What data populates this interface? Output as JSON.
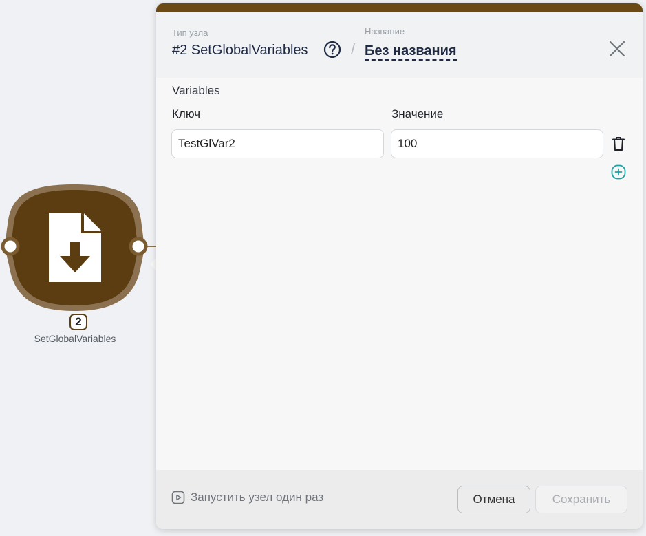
{
  "node": {
    "number": "2",
    "caption": "SetGlobalVariables",
    "color": "#5c3d12",
    "ring_color": "#8b7150",
    "icon": "file-download-icon"
  },
  "panel": {
    "accent_color": "#6b4a15",
    "header": {
      "type_label": "Тип узла",
      "type_value": "#2 SetGlobalVariables",
      "separator": "/",
      "name_label": "Название",
      "name_value": "Без названия"
    },
    "section_label": "Variables",
    "columns": {
      "key": "Ключ",
      "value": "Значение"
    },
    "rows": [
      {
        "key": "TestGlVar2",
        "value": "100"
      }
    ],
    "footer": {
      "run_once": "Запустить узел один раз",
      "cancel": "Отмена",
      "save": "Сохранить"
    }
  },
  "icons": {
    "help": "question-circle-icon",
    "close": "close-icon",
    "delete": "trash-icon",
    "add": "plus-circle-icon",
    "run": "play-square-icon"
  },
  "colors": {
    "add_icon": "#1aa3a3",
    "title_text": "#1f2a44"
  }
}
